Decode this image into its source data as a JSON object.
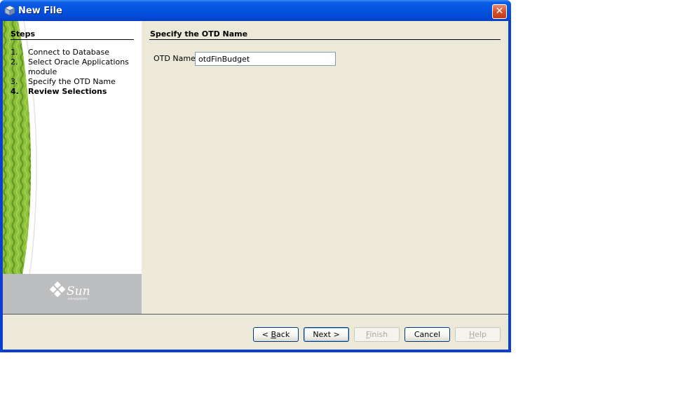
{
  "window": {
    "title": "New File",
    "icon": "cube-icon",
    "close_icon": "close-icon"
  },
  "sidebar": {
    "heading": "Steps",
    "steps": [
      {
        "number": "1.",
        "label": "Connect to Database",
        "current": false
      },
      {
        "number": "2.",
        "label": "Select Oracle Applications module",
        "current": false
      },
      {
        "number": "3.",
        "label": "Specify the OTD Name",
        "current": false
      },
      {
        "number": "4.",
        "label": "Review Selections",
        "current": true
      }
    ],
    "logo": "sun-microsystems-logo"
  },
  "content": {
    "title": "Specify the OTD Name",
    "otd_name": {
      "label": "OTD Name:",
      "value": "otdFinBudget"
    }
  },
  "buttons": {
    "back": {
      "prefix": "< ",
      "mnemonic": "B",
      "rest": "ack",
      "enabled": true
    },
    "next": {
      "label": "Next >",
      "enabled": true,
      "default": true
    },
    "finish": {
      "mnemonic": "F",
      "rest": "inish",
      "enabled": false
    },
    "cancel": {
      "label": "Cancel",
      "enabled": true
    },
    "help": {
      "mnemonic": "H",
      "rest": "elp",
      "enabled": false
    }
  },
  "colors": {
    "titlebar": "#0553e0",
    "dialog_bg": "#ece9d8",
    "logo_bg": "#bdbec0",
    "leaf_green": "#7fb02a"
  }
}
